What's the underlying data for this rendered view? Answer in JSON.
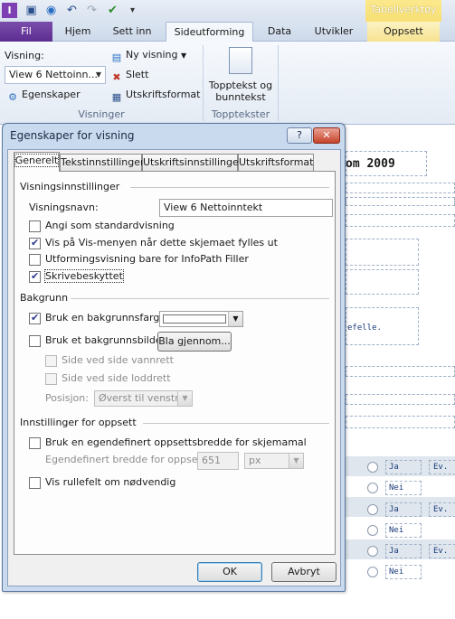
{
  "qat": {
    "icons": [
      "infopath-icon",
      "save-icon",
      "publish-icon",
      "undo-icon",
      "redo-icon",
      "spell-check-icon",
      "customize-qat-icon"
    ]
  },
  "ribbon": {
    "contextual_group": "Tabellverktøy",
    "tabs": [
      {
        "label": "Fil"
      },
      {
        "label": "Hjem"
      },
      {
        "label": "Sett inn"
      },
      {
        "label": "Sideutforming"
      },
      {
        "label": "Data"
      },
      {
        "label": "Utvikler"
      },
      {
        "label": "Oppsett"
      }
    ],
    "views_label": "Visning:",
    "view_select": "View 6 Nettoinn...",
    "new_view": "Ny visning",
    "delete": "Slett",
    "properties": "Egenskaper",
    "print_format": "Utskriftsformat",
    "group_views": "Visninger",
    "header_footer_line1": "Topptekst og",
    "header_footer_line2": "bunntekst",
    "group_header": "Topptekster"
  },
  "doc": {
    "title_fragment": "om 2009",
    "text_fragment": "efelle.",
    "rows": [
      {
        "a": "Ja",
        "b": "Ev."
      },
      {
        "a": "Nei",
        "b": ""
      },
      {
        "a": "Ja",
        "b": "Ev."
      },
      {
        "a": "Nei",
        "b": ""
      },
      {
        "a": "Ja",
        "b": "Ev."
      },
      {
        "a": "Nei",
        "b": ""
      }
    ]
  },
  "dialog": {
    "title": "Egenskaper for visning",
    "help": "?",
    "close": "✕",
    "tabs": [
      "Generelt",
      "Tekstinnstillinger",
      "Utskriftsinnstillinger",
      "Utskriftsformat"
    ],
    "section_view": "Visningsinnstillinger",
    "view_name_label": "Visningsnavn:",
    "view_name_value": "View 6 Nettoinntekt",
    "cb_default": {
      "label": "Angi som standardvisning",
      "checked": false
    },
    "cb_show_menu": {
      "label": "Vis på Vis-menyen når dette skjemaet fylles ut",
      "checked": true
    },
    "cb_design_only": {
      "label": "Utformingsvisning bare for InfoPath Filler",
      "checked": false
    },
    "cb_readonly": {
      "label": "Skrivebeskyttet",
      "checked": true
    },
    "section_background": "Bakgrunn",
    "cb_bg_color": {
      "label": "Bruk en bakgrunnsfarge",
      "checked": true
    },
    "cb_bg_image": {
      "label": "Bruk et bakgrunnsbilde",
      "checked": false
    },
    "browse_button": "Bla gjennom...",
    "cb_tile_horizontal": "Side ved side vannrett",
    "cb_tile_vertical": "Side ved side loddrett",
    "position_label": "Posisjon:",
    "position_value": "Øverst til venstre",
    "section_layout": "Innstillinger for oppsett",
    "cb_custom_width": {
      "label": "Bruk en egendefinert oppsettsbredde for skjemamal",
      "checked": false
    },
    "custom_width_label": "Egendefinert bredde for oppsett:",
    "custom_width_value": "651",
    "custom_width_unit": "px",
    "cb_scrollbars": {
      "label": "Vis rullefelt om nødvendig",
      "checked": false
    },
    "ok_button": "OK",
    "cancel_button": "Avbryt"
  }
}
